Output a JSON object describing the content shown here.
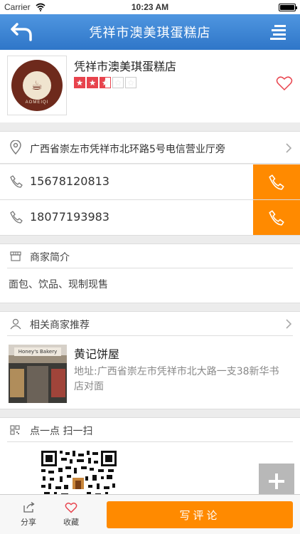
{
  "status_bar": {
    "carrier": "Carrier",
    "time": "10:23 AM"
  },
  "nav": {
    "title": "凭祥市澳美琪蛋糕店"
  },
  "shop": {
    "name": "凭祥市澳美琪蛋糕店",
    "logo_text": "AOMEIQI",
    "rating": 2.5,
    "rating_max": 5
  },
  "address": {
    "text": "广西省崇左市凭祥市北环路5号电信营业厅旁"
  },
  "phones": [
    {
      "number": "15678120813"
    },
    {
      "number": "18077193983"
    }
  ],
  "intro": {
    "heading": "商家简介",
    "text": "面包、饮品、现制现售"
  },
  "recommend": {
    "heading": "相关商家推荐",
    "name": "黄记饼屋",
    "address": "地址:广西省崇左市凭祥市北大路一支38新华书店对面",
    "sign_text": "Honey's Bakery"
  },
  "qr": {
    "heading": "点一点 扫一扫"
  },
  "bottom": {
    "share": "分享",
    "favorite": "收藏",
    "review": "写评论"
  },
  "colors": {
    "nav_blue": "#3a82d4",
    "accent_orange": "#ff8a00",
    "star_red": "#e8434d"
  }
}
